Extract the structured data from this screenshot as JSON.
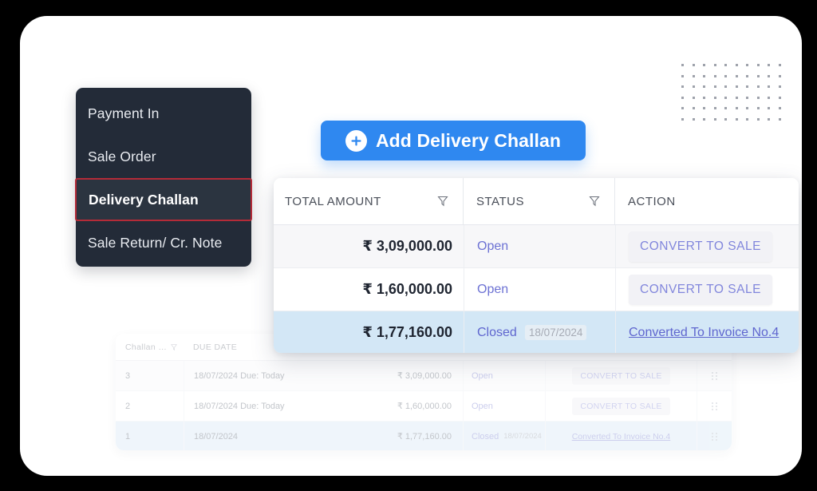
{
  "sidebar": {
    "items": [
      {
        "label": "Payment In",
        "selected": false
      },
      {
        "label": "Sale Order",
        "selected": false
      },
      {
        "label": "Delivery Challan",
        "selected": true
      },
      {
        "label": "Sale Return/ Cr. Note",
        "selected": false
      }
    ]
  },
  "add_button": {
    "label": "Add Delivery Challan",
    "icon": "plus-circle-icon",
    "color": "#2f88f0"
  },
  "overlay_table": {
    "columns": [
      {
        "label": "TOTAL AMOUNT",
        "filter": true
      },
      {
        "label": "STATUS",
        "filter": true
      },
      {
        "label": "ACTION",
        "filter": false
      }
    ],
    "rows": [
      {
        "amount": "₹ 3,09,000.00",
        "status": "Open",
        "status_date": "",
        "action_label": "CONVERT TO SALE",
        "action_type": "button",
        "selected": false
      },
      {
        "amount": "₹ 1,60,000.00",
        "status": "Open",
        "status_date": "",
        "action_label": "CONVERT TO SALE",
        "action_type": "button",
        "selected": false
      },
      {
        "amount": "₹ 1,77,160.00",
        "status": "Closed",
        "status_date": "18/07/2024",
        "action_label": "Converted To Invoice No.4",
        "action_type": "link",
        "selected": true
      }
    ]
  },
  "background_table": {
    "columns": [
      {
        "label": "Challan …",
        "filter": true
      },
      {
        "label": "DUE DATE",
        "filter": false
      },
      {
        "label": "",
        "filter": false
      },
      {
        "label": "",
        "filter": false
      },
      {
        "label": "",
        "filter": false
      }
    ],
    "rows": [
      {
        "challan_no": "3",
        "due_date": "18/07/2024 Due: Today",
        "amount": "₹ 3,09,000.00",
        "status": "Open",
        "status_date": "",
        "action_label": "CONVERT TO SALE",
        "action_type": "button",
        "grip": "drag-handle-icon",
        "selected": false
      },
      {
        "challan_no": "2",
        "due_date": "18/07/2024 Due: Today",
        "amount": "₹ 1,60,000.00",
        "status": "Open",
        "status_date": "",
        "action_label": "CONVERT TO SALE",
        "action_type": "button",
        "grip": "drag-handle-icon",
        "selected": false
      },
      {
        "challan_no": "1",
        "due_date": "18/07/2024",
        "amount": "₹ 1,77,160.00",
        "status": "Closed",
        "status_date": "18/07/2024",
        "action_label": "Converted To Invoice No.4",
        "action_type": "link",
        "grip": "drag-handle-icon",
        "selected": true
      }
    ]
  },
  "decoration": {
    "dot_grid_columns": 10,
    "dot_grid_rows": 6,
    "dot_color": "#9ea2ab"
  }
}
